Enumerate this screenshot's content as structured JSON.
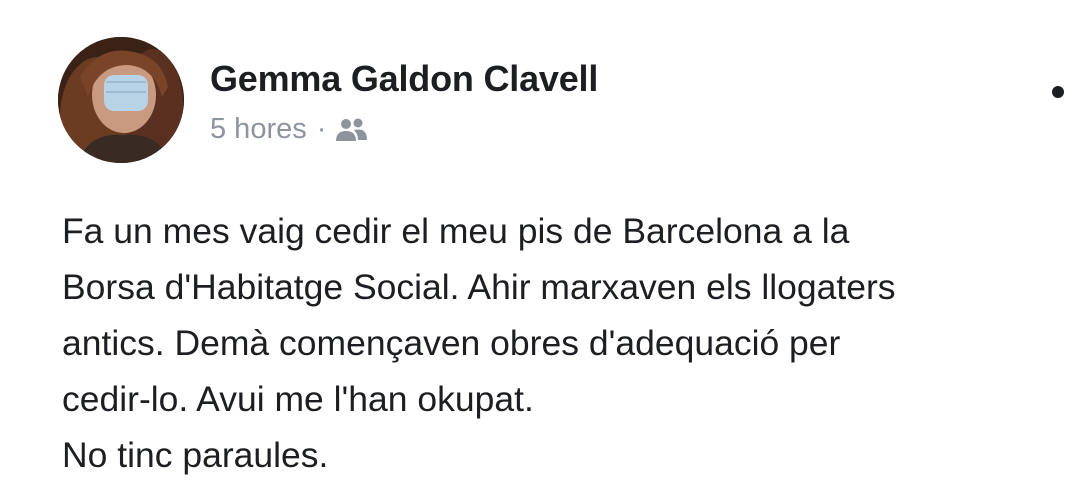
{
  "post": {
    "author": "Gemma Galdon Clavell",
    "timestamp": "5 hores",
    "separator": "·",
    "audience_icon": "friends-icon",
    "menu_icon": "more-options-icon",
    "lines": [
      "Fa un mes vaig cedir el meu pis de Barcelona a la",
      "Borsa d'Habitatge Social. Ahir marxaven els llogaters",
      "antics. Demà començaven obres d'adequació per",
      "cedir-lo. Avui me l'han okupat.",
      "No tinc paraules."
    ]
  },
  "colors": {
    "text": "#1c1e21",
    "meta": "#8d949e",
    "background": "#ffffff"
  }
}
